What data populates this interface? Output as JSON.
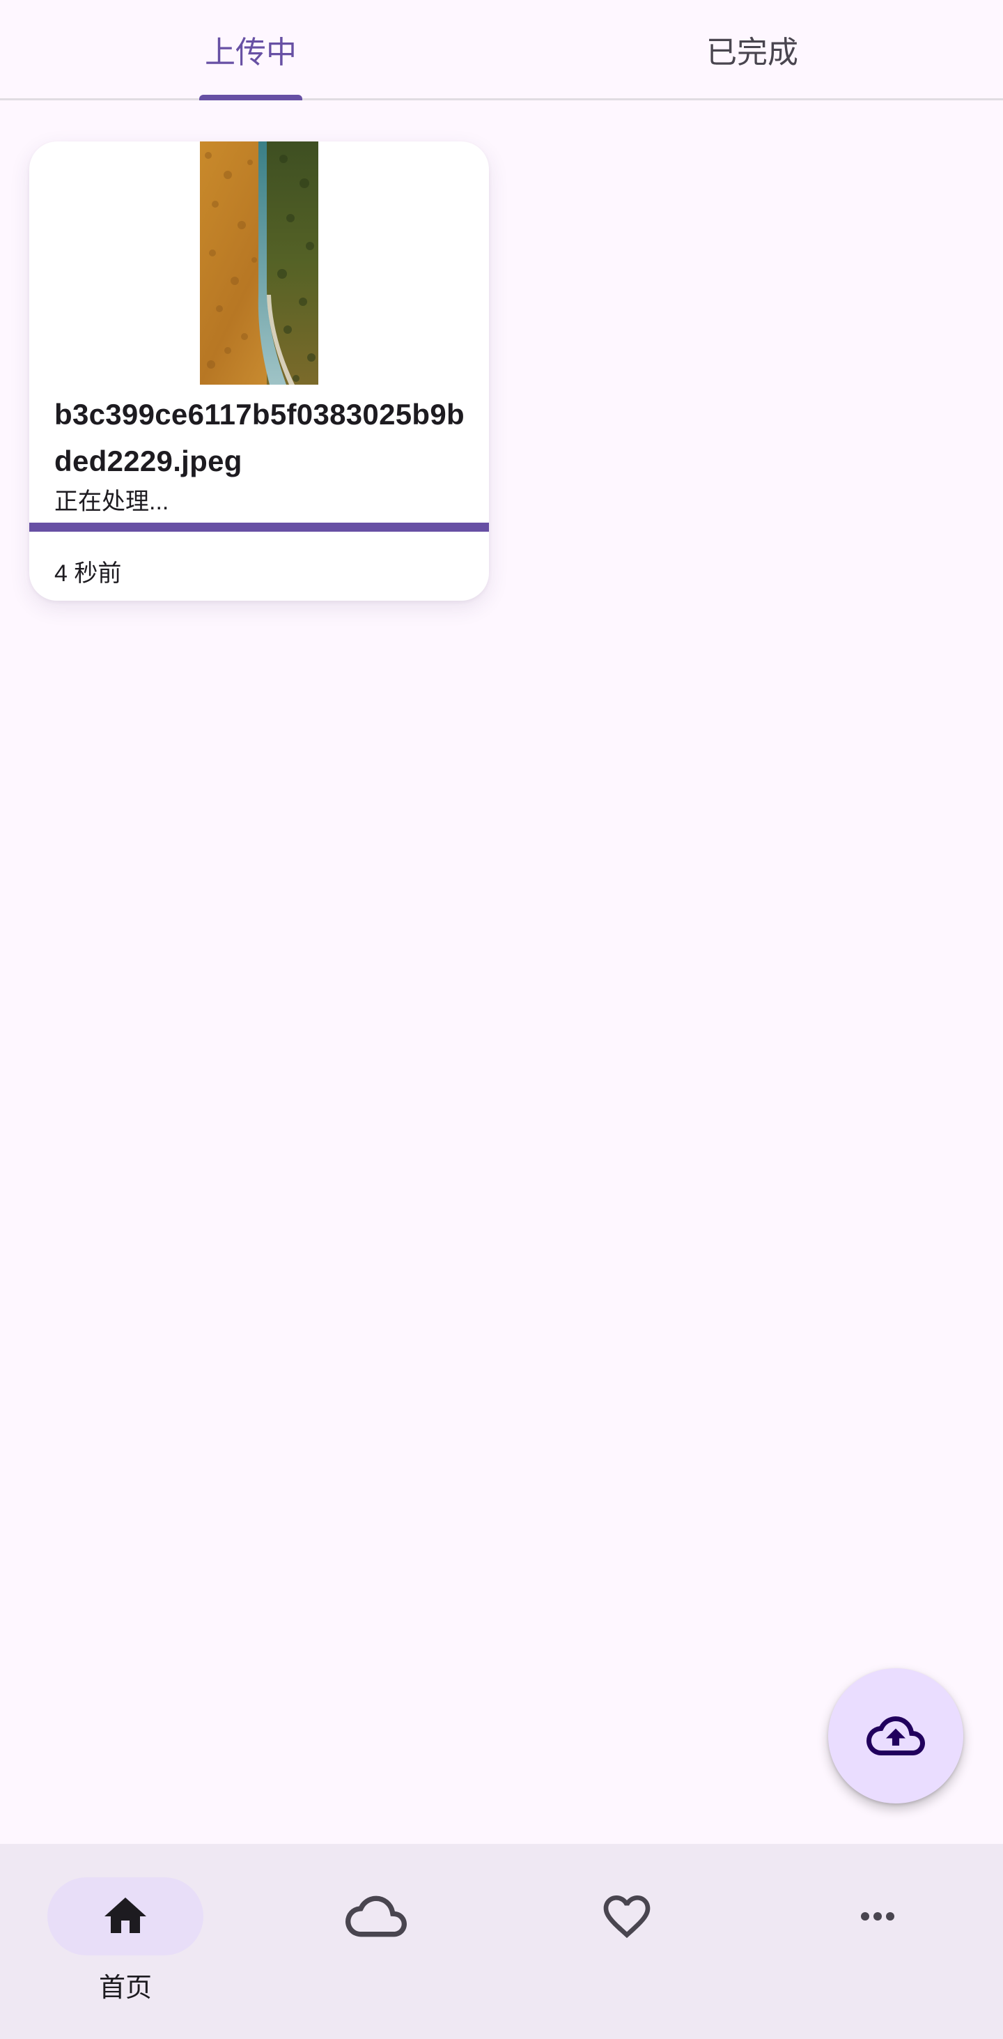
{
  "tabs": {
    "uploading_label": "上传中",
    "completed_label": "已完成",
    "active_color": "#6750A4",
    "inactive_color": "#49454F"
  },
  "upload_card": {
    "file_name": "b3c399ce6117b5f0383025b9bded2229.jpeg",
    "status": "正在处理...",
    "progress": 1.0,
    "timestamp": "4 秒前",
    "thumbnail": "aerial-road-forest-photo"
  },
  "fab": {
    "icon": "cloud-upload-icon",
    "color": "#EADDFF"
  },
  "bottom_nav": {
    "items": [
      {
        "label": "首页",
        "icon": "home-icon",
        "active": true
      },
      {
        "label": "",
        "icon": "cloud-icon",
        "active": false
      },
      {
        "label": "",
        "icon": "heart-icon",
        "active": false
      },
      {
        "label": "",
        "icon": "more-horizontal-icon",
        "active": false
      }
    ]
  },
  "colors": {
    "background": "#FEF7FF",
    "primary": "#6750A4",
    "nav_background": "#EFE8F3",
    "active_indicator": "#E8DEF8"
  }
}
